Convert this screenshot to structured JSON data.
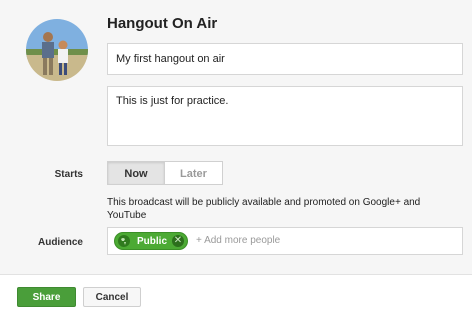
{
  "dialog": {
    "title": "Hangout On Air",
    "name_value": "My first hangout on air",
    "description_value": "This is just for practice.",
    "starts": {
      "label": "Starts",
      "options": [
        "Now",
        "Later"
      ],
      "selected": "Now"
    },
    "notice": "This broadcast will be publicly available and promoted on Google+ and YouTube",
    "audience": {
      "label": "Audience",
      "chip_label": "Public",
      "chip_remove": "✕",
      "add_placeholder": "+ Add more people"
    },
    "footer": {
      "share_label": "Share",
      "cancel_label": "Cancel"
    }
  },
  "colors": {
    "accent_green": "#4a9e3a",
    "chip_green": "#4caa34",
    "panel_bg": "#f6f6f6"
  },
  "icons": {
    "avatar": "profile-photo",
    "chip_icon": "globe-icon",
    "chip_remove": "close-icon"
  }
}
